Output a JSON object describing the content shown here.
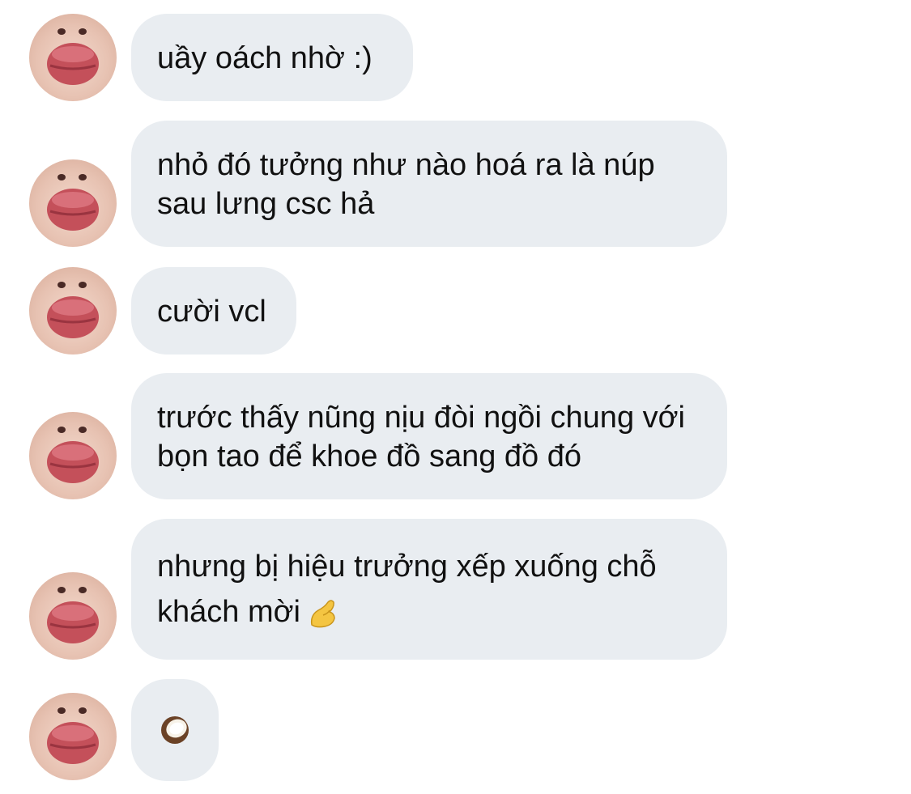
{
  "messages": [
    {
      "text": "uầy oách nhờ :)"
    },
    {
      "text": "nhỏ đó tưởng như nào hoá ra là núp sau lưng csc hả"
    },
    {
      "text": "cười vcl"
    },
    {
      "text": "trước thấy nũng nịu đòi ngồi chung với bọn tao để khoe đồ sang đồ đó"
    },
    {
      "text": "nhưng bị hiệu trưởng xếp xuống chỗ khách mời",
      "emoji": "pinching-hand-emoji"
    },
    {
      "text": "",
      "emoji": "coconut-emoji"
    }
  ],
  "colors": {
    "bubble": "#e9edf1",
    "text": "#111111",
    "lips": "#c4505a"
  }
}
